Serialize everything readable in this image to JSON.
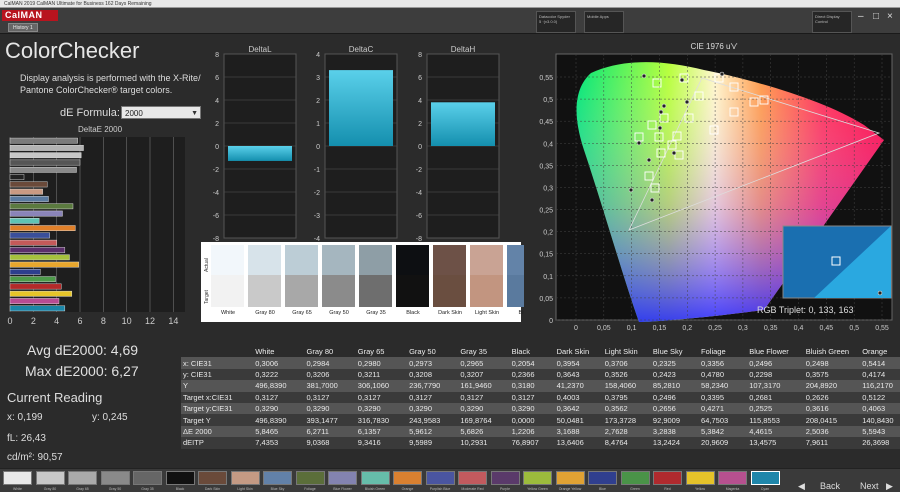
{
  "window": {
    "title": "CalMAN 2019 CalMAN Ultimate for Business 162 Days Remaining",
    "logo": "CalMAN",
    "history_tab": "History 1"
  },
  "sources": [
    {
      "label": "Datacolor Spyder 5 ·(v3.0.0)"
    },
    {
      "label": "Mobile Apps"
    },
    {
      "label": "Direct Display Control"
    }
  ],
  "page": {
    "title": "ColorChecker",
    "description": "Display analysis is performed with the X-Rite/ Pantone ColorChecker® target colors.",
    "formula_label": "dE Formula:",
    "formula_value": "2000"
  },
  "delta_charts": {
    "deltaL": {
      "title": "DeltaL",
      "value": -1.3
    },
    "deltaC": {
      "title": "DeltaC",
      "value": 3.3
    },
    "deltaH": {
      "title": "DeltaH",
      "value": 3.8
    },
    "y_ticks": [
      "8",
      "6",
      "4",
      "2",
      "0",
      "-2",
      "-4",
      "-6",
      "-8"
    ],
    "y_ticks_small": [
      "4",
      "3",
      "2",
      "1",
      "0",
      "-1",
      "-2",
      "-3",
      "-4"
    ]
  },
  "de2000_chart": {
    "title": "DeltaE 2000",
    "x_ticks": [
      "0",
      "2",
      "4",
      "6",
      "8",
      "10",
      "12",
      "14"
    ],
    "bars": [
      {
        "value": 5.8,
        "color": "#7b7b7b"
      },
      {
        "value": 6.3,
        "color": "#b3b3b3"
      },
      {
        "value": 6.1,
        "color": "#c7c7c7"
      },
      {
        "value": 6.0,
        "color": "#555"
      },
      {
        "value": 5.7,
        "color": "#8a8a8a"
      },
      {
        "value": 1.2,
        "color": "#222"
      },
      {
        "value": 3.2,
        "color": "#6a4a3a"
      },
      {
        "value": 2.8,
        "color": "#c99a83"
      },
      {
        "value": 3.3,
        "color": "#5a7aa0"
      },
      {
        "value": 5.4,
        "color": "#5b7a3f"
      },
      {
        "value": 4.5,
        "color": "#8a84b8"
      },
      {
        "value": 2.5,
        "color": "#5fc3b4"
      },
      {
        "value": 5.6,
        "color": "#e0802a"
      },
      {
        "value": 3.4,
        "color": "#3a4f9a"
      },
      {
        "value": 4.0,
        "color": "#c45a5a"
      },
      {
        "value": 4.7,
        "color": "#5b2f6a"
      },
      {
        "value": 5.1,
        "color": "#a6c13e"
      },
      {
        "value": 5.9,
        "color": "#e8a72e"
      },
      {
        "value": 2.6,
        "color": "#2d3f8d"
      },
      {
        "value": 3.9,
        "color": "#4d9a4a"
      },
      {
        "value": 4.4,
        "color": "#b32a2a"
      },
      {
        "value": 5.3,
        "color": "#e6c52a"
      },
      {
        "value": 4.2,
        "color": "#b84c93"
      },
      {
        "value": 4.7,
        "color": "#1c86a8"
      }
    ]
  },
  "swatches": {
    "actual_label": "Actual",
    "target_label": "Target",
    "items": [
      {
        "name": "White",
        "actual": "#f2f7fb",
        "target": "#f2f2f2"
      },
      {
        "name": "Gray 80",
        "actual": "#d7e3ea",
        "target": "#c9c9c9"
      },
      {
        "name": "Gray 65",
        "actual": "#bccdd6",
        "target": "#a8a8a8"
      },
      {
        "name": "Gray 50",
        "actual": "#a5b6bf",
        "target": "#8b8b8b"
      },
      {
        "name": "Gray 35",
        "actual": "#8e9ea6",
        "target": "#6e6e6e"
      },
      {
        "name": "Black",
        "actual": "#0d0f12",
        "target": "#111111"
      },
      {
        "name": "Dark Skin",
        "actual": "#6d5147",
        "target": "#6a4e40"
      },
      {
        "name": "Light Skin",
        "actual": "#c9a394",
        "target": "#c29580"
      },
      {
        "name": "Blue",
        "actual": "#6383a8",
        "target": "#5a7a9e"
      }
    ]
  },
  "stats": {
    "avg": "Avg dE2000: 4,69",
    "max": "Max dE2000: 6,27"
  },
  "current_reading": {
    "title": "Current Reading",
    "x": "x: 0,199",
    "y": "y: 0,245",
    "fl": "fL: 26,43",
    "cdm2": "cd/m²: 90,57"
  },
  "cie_chart": {
    "title": "CIE 1976 u'v'",
    "x_ticks": [
      "0",
      "0,05",
      "0,1",
      "0,15",
      "0,2",
      "0,25",
      "0,3",
      "0,35",
      "0,4",
      "0,45",
      "0,5",
      "0,55"
    ],
    "y_ticks": [
      "0,55",
      "0,5",
      "0,45",
      "0,4",
      "0,35",
      "0,3",
      "0,25",
      "0,2",
      "0,15",
      "0,1",
      "0,05",
      "0"
    ],
    "rgb_triplet": "RGB Triplet: 0, 133, 163"
  },
  "table": {
    "columns": [
      "",
      "White",
      "Gray 80",
      "Gray 65",
      "Gray 50",
      "Gray 35",
      "Black",
      "Dark Skin",
      "Light Skin",
      "Blue Sky",
      "Foliage",
      "Blue Flower",
      "Bluish Green",
      "Orange",
      "Pur"
    ],
    "rows": [
      [
        "x: CIE31",
        "0,3006",
        "0,2984",
        "0,2980",
        "0,2973",
        "0,2965",
        "0,2054",
        "0,3954",
        "0,3706",
        "0,2325",
        "0,3356",
        "0,2496",
        "0,2498",
        "0,5414",
        "0,2"
      ],
      [
        "y: CIE31",
        "0,3222",
        "0,3206",
        "0,3211",
        "0,3208",
        "0,3207",
        "0,2366",
        "0,3643",
        "0,3526",
        "0,2423",
        "0,4780",
        "0,2298",
        "0,3575",
        "0,4174",
        "0,1"
      ],
      [
        "Y",
        "496,8390",
        "381,7000",
        "306,1060",
        "236,7790",
        "161,9460",
        "0,3180",
        "41,2370",
        "158,4060",
        "85,2810",
        "58,2340",
        "107,3170",
        "204,8920",
        "116,2170",
        "51,"
      ],
      [
        "Target x:CIE31",
        "0,3127",
        "0,3127",
        "0,3127",
        "0,3127",
        "0,3127",
        "0,3127",
        "0,4003",
        "0,3795",
        "0,2496",
        "0,3395",
        "0,2681",
        "0,2626",
        "0,5122",
        "0,2"
      ],
      [
        "Target y:CIE31",
        "0,3290",
        "0,3290",
        "0,3290",
        "0,3290",
        "0,3290",
        "0,3290",
        "0,3642",
        "0,3562",
        "0,2656",
        "0,4271",
        "0,2525",
        "0,3616",
        "0,4063",
        "0,1"
      ],
      [
        "Target Y",
        "496,8390",
        "393,1477",
        "316,7830",
        "243,9583",
        "169,8764",
        "0,0000",
        "50,0481",
        "173,3728",
        "92,9009",
        "64,7503",
        "115,8553",
        "208,0415",
        "140,8430",
        "58,"
      ],
      [
        "ΔE 2000",
        "5,8465",
        "6,2711",
        "6,1357",
        "5,9612",
        "5,6826",
        "1,2206",
        "3,1688",
        "2,7628",
        "3,2838",
        "5,3842",
        "4,4615",
        "2,5036",
        "5,5943",
        "3,6"
      ],
      [
        "dEITP",
        "7,4353",
        "9,0368",
        "9,3416",
        "9,5989",
        "10,2931",
        "76,8907",
        "13,6406",
        "8,4764",
        "13,2424",
        "20,9609",
        "13,4575",
        "7,9611",
        "26,3698",
        "16,"
      ]
    ]
  },
  "bottom_bar": {
    "swatches": [
      {
        "label": "White",
        "color": "#e8e8e8"
      },
      {
        "label": "Gray 80",
        "color": "#c8c8c8"
      },
      {
        "label": "Gray 65",
        "color": "#aaaaaa"
      },
      {
        "label": "Gray 50",
        "color": "#8a8a8a"
      },
      {
        "label": "Gray 35",
        "color": "#666666"
      },
      {
        "label": "Black",
        "color": "#111111"
      },
      {
        "label": "Dark Skin",
        "color": "#6a4a3a"
      },
      {
        "label": "Light Skin",
        "color": "#c49a84"
      },
      {
        "label": "Blue Sky",
        "color": "#6281a8"
      },
      {
        "label": "Foliage",
        "color": "#5b6e3a"
      },
      {
        "label": "Blue Flower",
        "color": "#8383b0"
      },
      {
        "label": "Bluish Green",
        "color": "#66bdaa"
      },
      {
        "label": "Orange",
        "color": "#d98030"
      },
      {
        "label": "Purplish Blue",
        "color": "#4a55a0"
      },
      {
        "label": "Moderate Red",
        "color": "#c25a5e"
      },
      {
        "label": "Purple",
        "color": "#5a3a6a"
      },
      {
        "label": "Yellow Green",
        "color": "#9cbb3c"
      },
      {
        "label": "Orange Yellow",
        "color": "#e0a234"
      },
      {
        "label": "Blue",
        "color": "#303f8f"
      },
      {
        "label": "Green",
        "color": "#4a9348"
      },
      {
        "label": "Red",
        "color": "#b02a2e"
      },
      {
        "label": "Yellow",
        "color": "#e5c22a"
      },
      {
        "label": "Magenta",
        "color": "#b6508f"
      },
      {
        "label": "Cyan",
        "color": "#1f86aa"
      }
    ],
    "back": "Back",
    "next": "Next"
  }
}
